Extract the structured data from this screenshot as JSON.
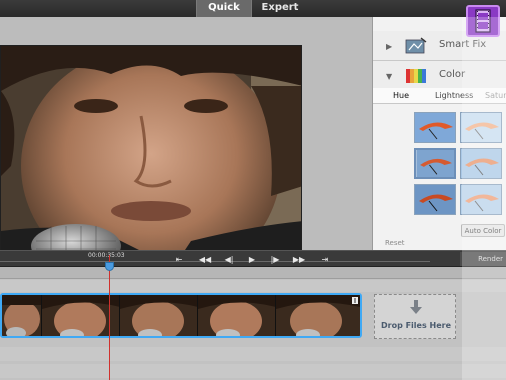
{
  "modes": {
    "quick": "Quick",
    "expert": "Expert"
  },
  "panel": {
    "smart_fix": "Smart Fix",
    "color": "Color",
    "subtabs": [
      "Hue",
      "Lightness",
      "Saturation"
    ],
    "auto_color": "Auto Color",
    "reset": "Reset"
  },
  "transport": {
    "timecode": "00:00:35:03",
    "render": "Render"
  },
  "timeline": {
    "drop_files": "Drop Files Here"
  },
  "colors": {
    "accent": "#3fa9f5",
    "playhead": "#d0312d",
    "badge": "#8a3ac4"
  },
  "icons": [
    "filmstrip-icon",
    "smart-fix-icon",
    "color-swatch-icon",
    "arrow-down-icon"
  ]
}
